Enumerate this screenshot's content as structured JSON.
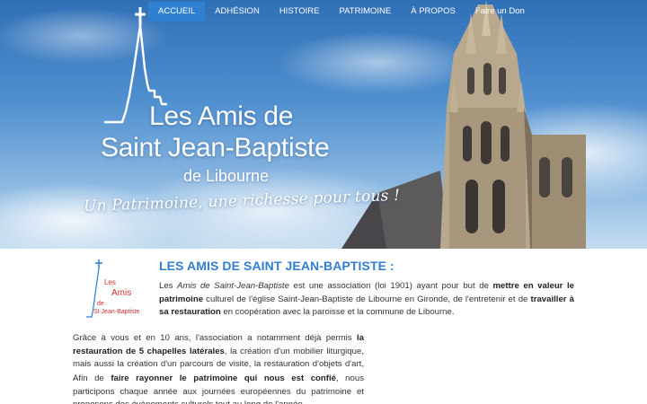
{
  "nav": {
    "items": [
      {
        "label": "ACCUEIL",
        "active": true
      },
      {
        "label": "ADHÉSION",
        "active": false
      },
      {
        "label": "HISTOIRE",
        "active": false
      },
      {
        "label": "PATRIMOINE",
        "active": false
      },
      {
        "label": "À PROPOS",
        "active": false
      },
      {
        "label": "Faire un Don",
        "active": false
      }
    ]
  },
  "hero": {
    "logo_line1": "Les Amis de",
    "logo_line2": "Saint Jean-Baptiste",
    "logo_line3": "de Libourne",
    "tagline": "Un Patrimoine, une richesse pour tous !"
  },
  "content": {
    "small_logo": {
      "line1": "Les",
      "line2": "Amis",
      "line3": "de",
      "line4": "St Jean-Baptiste"
    },
    "title": "LES AMIS DE SAINT JEAN-BAPTISTE :",
    "p1": {
      "t1": "Les ",
      "t2": "Amis de Saint-Jean-Baptiste",
      "t3": " est une association (loi 1901) ayant pour but de ",
      "t4": "mettre en valeur le patrimoine",
      "t5": " culturel de l'église Saint-Jean-Baptiste de Libourne en Gironde, de l'entretenir et de ",
      "t6": "travailler à sa restauration",
      "t7": " en coopération avec la paroisse et la commune de Libourne."
    },
    "p2": {
      "t1": "Grâce à vous et en 10 ans, l'association a notamment déjà permis ",
      "t2": "la restauration de 5 chapelles latérales",
      "t3": ", la création d'un mobilier liturgique, mais aussi la création d'un parcours de visite, la restauration d'objets d'art, …"
    },
    "p3": {
      "t1": "Afin de ",
      "t2": "faire rayonner le patrimoine qui nous est confié",
      "t3": ", nous participons chaque année aux journées européennes du patrimoine et proposons des évènements culturels tout au long de l'année."
    }
  },
  "colors": {
    "accent": "#2f7fd3",
    "sky_top": "#2f6fb6",
    "logo_red": "#d32f2f"
  }
}
